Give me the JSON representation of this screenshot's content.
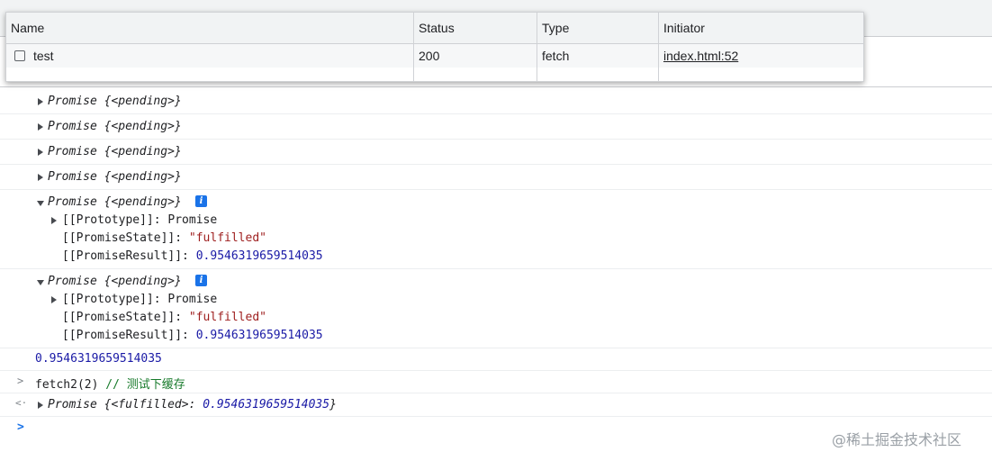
{
  "network": {
    "columns": [
      "Name",
      "Status",
      "Type",
      "Initiator"
    ],
    "row": {
      "name": "test",
      "status": "200",
      "type": "fetch",
      "initiator": "index.html:52"
    }
  },
  "console": {
    "promise_label": "Promise",
    "pending_text": "{<pending>}",
    "prototype_key": "[[Prototype]]: ",
    "prototype_value": "Promise",
    "state_key": "[[PromiseState]]: ",
    "state_value": "\"fulfilled\"",
    "result_key": "[[PromiseResult]]: ",
    "result_value": "0.9546319659514035",
    "logged_value": "0.9546319659514035",
    "input_code": "fetch2(2) ",
    "input_comment": "// 测试下缓存",
    "output_prefix": "{<fulfilled>: ",
    "output_value": "0.9546319659514035",
    "output_suffix": "}",
    "info_glyph": "i",
    "input_marker": ">",
    "output_marker": "<·",
    "prompt_marker": ">"
  },
  "watermark": "@稀土掘金技术社区",
  "colors": {
    "accent": "#1a73e8",
    "string": "#9e1e1e",
    "number": "#1a1aa6",
    "comment": "#177a2b"
  }
}
